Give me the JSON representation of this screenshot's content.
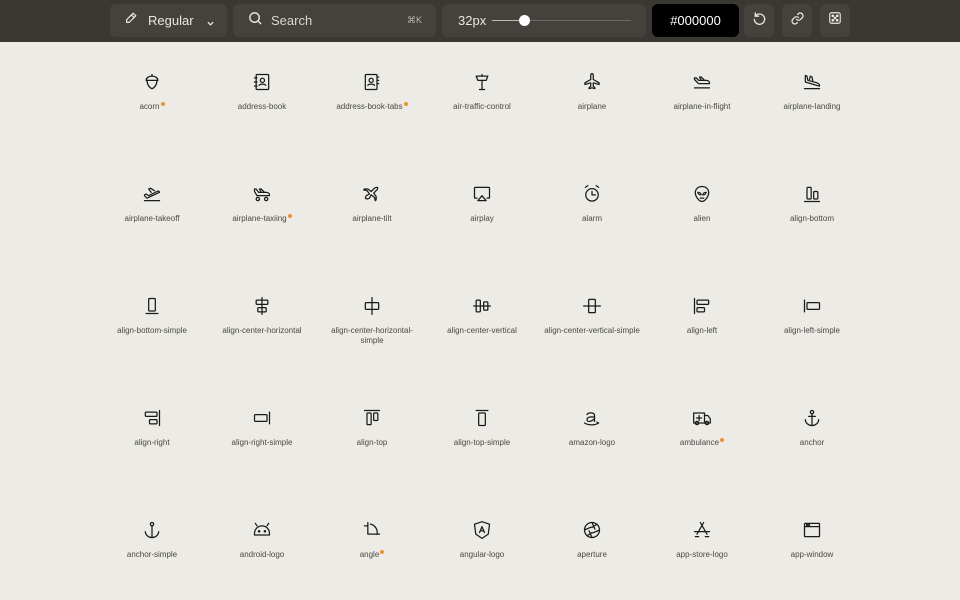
{
  "toolbar": {
    "weight_label": "Regular",
    "search_placeholder": "Search",
    "search_shortcut": "⌘K",
    "size_label": "32px",
    "size_level": 0.23,
    "color_value": "#000000"
  },
  "icons": [
    {
      "name": "acorn",
      "icon": "acorn-icon",
      "new": true
    },
    {
      "name": "address-book",
      "icon": "address-book-icon",
      "new": false
    },
    {
      "name": "address-book-tabs",
      "icon": "address-book-tabs-icon",
      "new": true
    },
    {
      "name": "air-traffic-control",
      "icon": "air-traffic-control-icon",
      "new": false
    },
    {
      "name": "airplane",
      "icon": "airplane-icon",
      "new": false
    },
    {
      "name": "airplane-in-flight",
      "icon": "airplane-in-flight-icon",
      "new": false
    },
    {
      "name": "airplane-landing",
      "icon": "airplane-landing-icon",
      "new": false
    },
    {
      "name": "airplane-takeoff",
      "icon": "airplane-takeoff-icon",
      "new": false
    },
    {
      "name": "airplane-taxiing",
      "icon": "airplane-taxiing-icon",
      "new": true
    },
    {
      "name": "airplane-tilt",
      "icon": "airplane-tilt-icon",
      "new": false
    },
    {
      "name": "airplay",
      "icon": "airplay-icon",
      "new": false
    },
    {
      "name": "alarm",
      "icon": "alarm-icon",
      "new": false
    },
    {
      "name": "alien",
      "icon": "alien-icon",
      "new": false
    },
    {
      "name": "align-bottom",
      "icon": "align-bottom-icon",
      "new": false
    },
    {
      "name": "align-bottom-simple",
      "icon": "align-bottom-simple-icon",
      "new": false
    },
    {
      "name": "align-center-horizontal",
      "icon": "align-center-horizontal-icon",
      "new": false
    },
    {
      "name": "align-center-horizontal-simple",
      "icon": "align-center-horizontal-simple-icon",
      "new": false
    },
    {
      "name": "align-center-vertical",
      "icon": "align-center-vertical-icon",
      "new": false
    },
    {
      "name": "align-center-vertical-simple",
      "icon": "align-center-vertical-simple-icon",
      "new": false
    },
    {
      "name": "align-left",
      "icon": "align-left-icon",
      "new": false
    },
    {
      "name": "align-left-simple",
      "icon": "align-left-simple-icon",
      "new": false
    },
    {
      "name": "align-right",
      "icon": "align-right-icon",
      "new": false
    },
    {
      "name": "align-right-simple",
      "icon": "align-right-simple-icon",
      "new": false
    },
    {
      "name": "align-top",
      "icon": "align-top-icon",
      "new": false
    },
    {
      "name": "align-top-simple",
      "icon": "align-top-simple-icon",
      "new": false
    },
    {
      "name": "amazon-logo",
      "icon": "amazon-logo-icon",
      "new": false
    },
    {
      "name": "ambulance",
      "icon": "ambulance-icon",
      "new": true
    },
    {
      "name": "anchor",
      "icon": "anchor-icon",
      "new": false
    },
    {
      "name": "anchor-simple",
      "icon": "anchor-simple-icon",
      "new": false
    },
    {
      "name": "android-logo",
      "icon": "android-logo-icon",
      "new": false
    },
    {
      "name": "angle",
      "icon": "angle-icon",
      "new": true
    },
    {
      "name": "angular-logo",
      "icon": "angular-logo-icon",
      "new": false
    },
    {
      "name": "aperture",
      "icon": "aperture-icon",
      "new": false
    },
    {
      "name": "app-store-logo",
      "icon": "app-store-logo-icon",
      "new": false
    },
    {
      "name": "app-window",
      "icon": "app-window-icon",
      "new": false
    }
  ]
}
